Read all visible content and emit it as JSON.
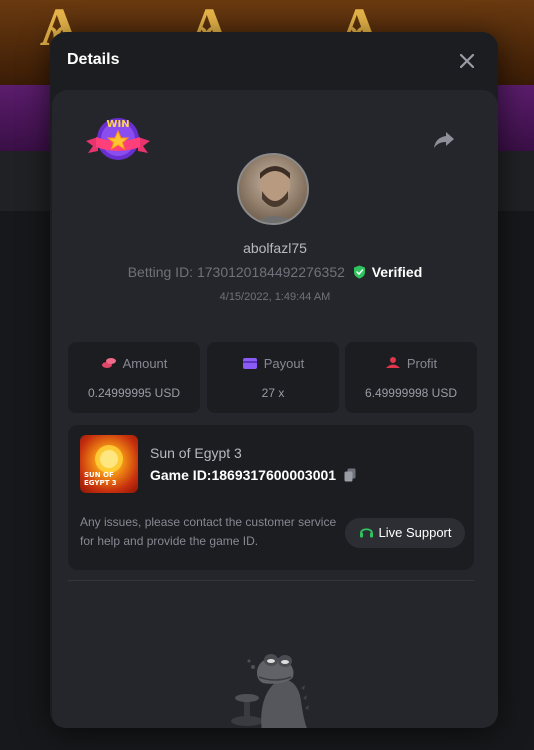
{
  "modal": {
    "title": "Details"
  },
  "bet": {
    "username": "abolfazl75",
    "betting_id_label": "Betting ID:",
    "betting_id": "1730120184492276352",
    "verified_label": "Verified",
    "timestamp": "4/15/2022, 1:49:44 AM"
  },
  "stats": [
    {
      "label": "Amount",
      "value": "0.24999995 USD",
      "icon": "coins-icon",
      "color": "#e0456a"
    },
    {
      "label": "Payout",
      "value": "27 x",
      "icon": "wallet-icon",
      "color": "#8a5cf5"
    },
    {
      "label": "Profit",
      "value": "6.49999998 USD",
      "icon": "profit-icon",
      "color": "#e0354a"
    }
  ],
  "game": {
    "name": "Sun of Egypt 3",
    "id_label": "Game ID:",
    "id": "1869317600003001",
    "thumb_text": "SUN OF EGYPT 3"
  },
  "support": {
    "message": "Any issues, please contact the customer service for help and provide the game ID.",
    "button_label": "Live Support"
  },
  "badge": {
    "text": "WIN"
  },
  "colors": {
    "verified_green": "#2ec35e",
    "support_green": "#2ec35e",
    "modal_bg": "#1c1d21",
    "card_bg": "#25262b"
  }
}
